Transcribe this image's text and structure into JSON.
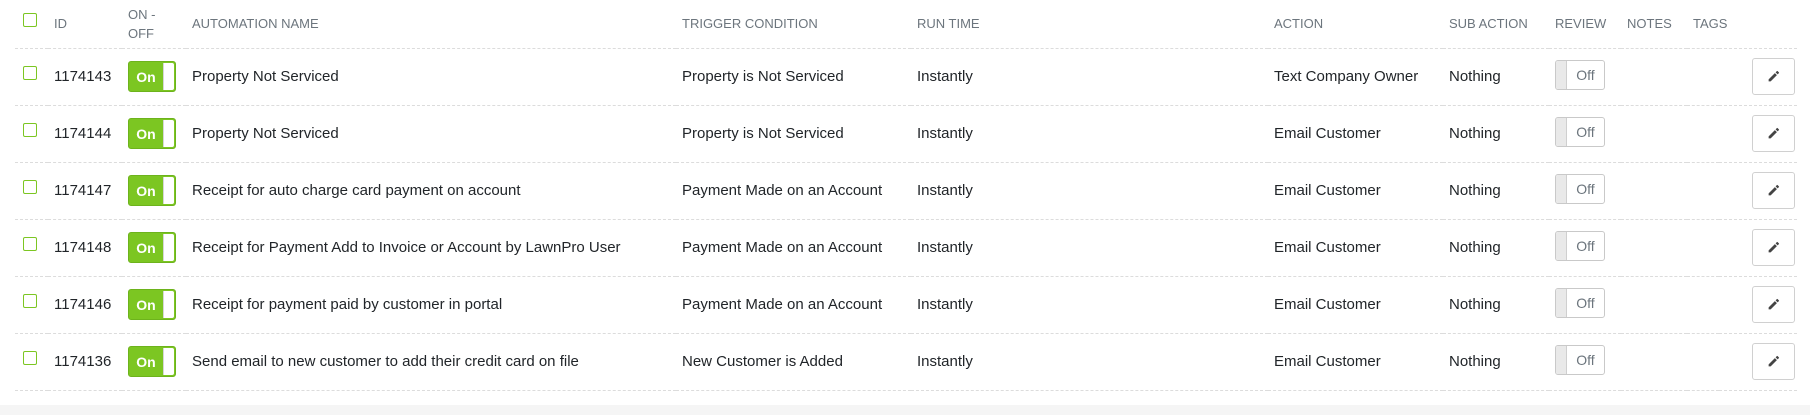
{
  "colors": {
    "accent_green": "#7cc622",
    "header_text": "#6c757d",
    "row_border": "#dcdcdc"
  },
  "headers": {
    "id": "ID",
    "on_off_line1": "ON -",
    "on_off_line2": "OFF",
    "automation_name": "AUTOMATION NAME",
    "trigger_condition": "TRIGGER CONDITION",
    "run_time": "RUN TIME",
    "action": "ACTION",
    "sub_action": "SUB ACTION",
    "review": "REVIEW",
    "notes": "NOTES",
    "tags": "TAGS"
  },
  "rows": [
    {
      "id": "1174143",
      "toggle": "On",
      "name": "Property Not Serviced",
      "trigger": "Property is Not Serviced",
      "run_time": "Instantly",
      "action": "Text Company Owner",
      "sub_action": "Nothing",
      "review": "Off",
      "notes": "",
      "tags": "",
      "edit_icon": "pencil-icon"
    },
    {
      "id": "1174144",
      "toggle": "On",
      "name": "Property Not Serviced",
      "trigger": "Property is Not Serviced",
      "run_time": "Instantly",
      "action": "Email Customer",
      "sub_action": "Nothing",
      "review": "Off",
      "notes": "",
      "tags": "",
      "edit_icon": "pencil-icon"
    },
    {
      "id": "1174147",
      "toggle": "On",
      "name": "Receipt for auto charge card payment on account",
      "trigger": "Payment Made on an Account",
      "run_time": "Instantly",
      "action": "Email Customer",
      "sub_action": "Nothing",
      "review": "Off",
      "notes": "",
      "tags": "",
      "edit_icon": "pencil-icon"
    },
    {
      "id": "1174148",
      "toggle": "On",
      "name": "Receipt for Payment Add to Invoice or Account by LawnPro User",
      "trigger": "Payment Made on an Account",
      "run_time": "Instantly",
      "action": "Email Customer",
      "sub_action": "Nothing",
      "review": "Off",
      "notes": "",
      "tags": "",
      "edit_icon": "pencil-icon"
    },
    {
      "id": "1174146",
      "toggle": "On",
      "name": "Receipt for payment paid by customer in portal",
      "trigger": "Payment Made on an Account",
      "run_time": "Instantly",
      "action": "Email Customer",
      "sub_action": "Nothing",
      "review": "Off",
      "notes": "",
      "tags": "",
      "edit_icon": "pencil-icon"
    },
    {
      "id": "1174136",
      "toggle": "On",
      "name": "Send email to new customer to add their credit card on file",
      "trigger": "New Customer is Added",
      "run_time": "Instantly",
      "action": "Email Customer",
      "sub_action": "Nothing",
      "review": "Off",
      "notes": "",
      "tags": "",
      "edit_icon": "pencil-icon"
    }
  ]
}
